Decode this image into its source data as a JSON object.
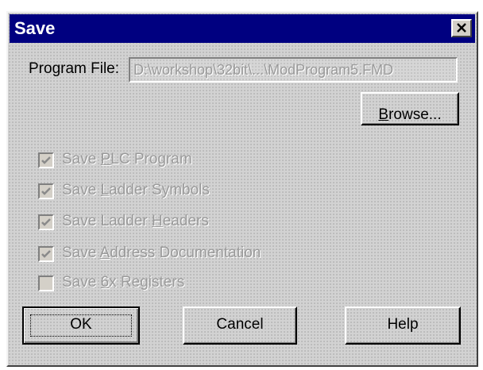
{
  "dialog": {
    "title": "Save",
    "close_icon": "close-icon"
  },
  "program_file": {
    "label": "Program File:",
    "value": "D:\\workshop\\32bit\\...\\ModProgram5.FMD"
  },
  "browse": {
    "label_pre": "",
    "label_key": "B",
    "label_post": "rowse..."
  },
  "options": [
    {
      "pre": "Save ",
      "key": "P",
      "post": "LC Program",
      "checked": true
    },
    {
      "pre": "Save ",
      "key": "L",
      "post": "adder Symbols",
      "checked": true
    },
    {
      "pre": "Save Ladder ",
      "key": "H",
      "post": "eaders",
      "checked": true
    },
    {
      "pre": "Save ",
      "key": "A",
      "post": "ddress Documentation",
      "checked": true
    },
    {
      "pre": "Save ",
      "key": "6",
      "post": "x Registers",
      "checked": false
    }
  ],
  "buttons": {
    "ok": "OK",
    "cancel": "Cancel",
    "help": "Help"
  }
}
